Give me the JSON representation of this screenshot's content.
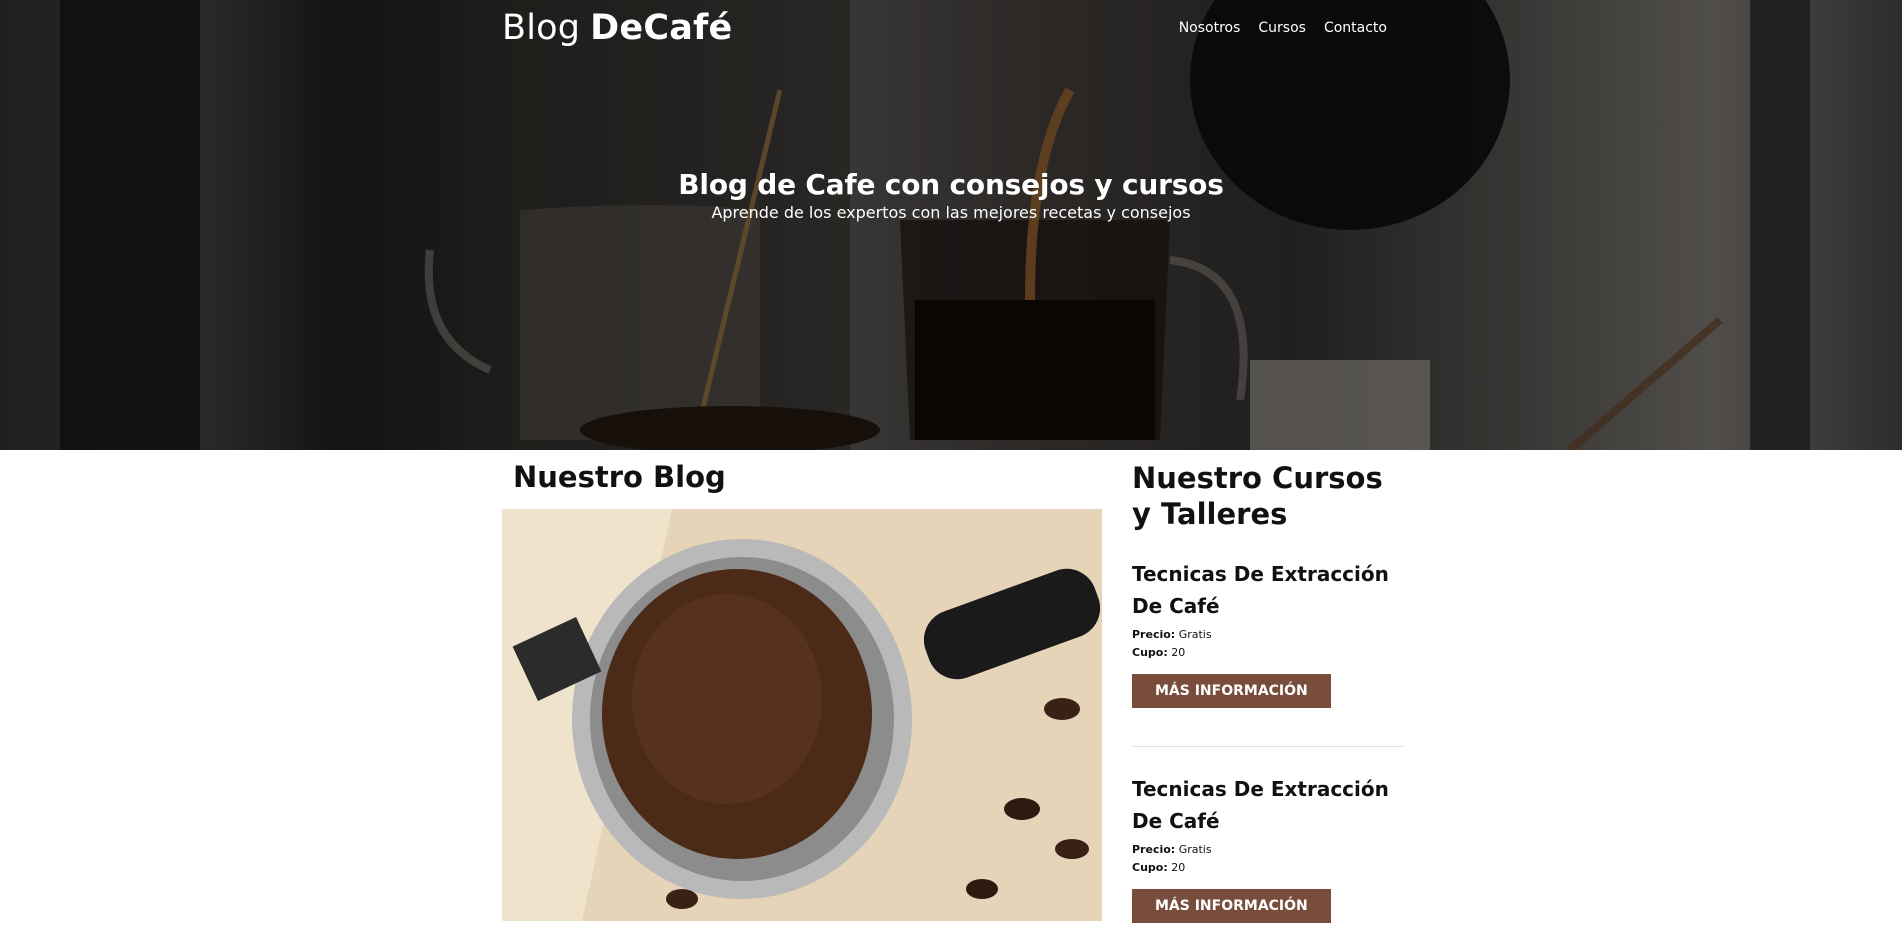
{
  "header": {
    "logo_light": "Blog",
    "logo_bold": "DeCafé",
    "nav": [
      "Nosotros",
      "Cursos",
      "Contacto"
    ]
  },
  "hero": {
    "title": "Blog de Cafe con consejos y cursos",
    "subtitle": "Aprende de los expertos con las mejores recetas y consejos"
  },
  "blog": {
    "heading": "Nuestro Blog"
  },
  "courses": {
    "heading": "Nuestro Cursos y Talleres",
    "items": [
      {
        "title": "Tecnicas De Extracción De Café",
        "price_label": "Precio:",
        "price": "Gratis",
        "seats_label": "Cupo:",
        "seats": "20",
        "button": "MÁS INFORMACIÓN"
      },
      {
        "title": "Tecnicas De Extracción De Café",
        "price_label": "Precio:",
        "price": "Gratis",
        "seats_label": "Cupo:",
        "seats": "20",
        "button": "MÁS INFORMACIÓN"
      }
    ]
  },
  "colors": {
    "button_bg": "#784d3c",
    "text": "#111111"
  }
}
